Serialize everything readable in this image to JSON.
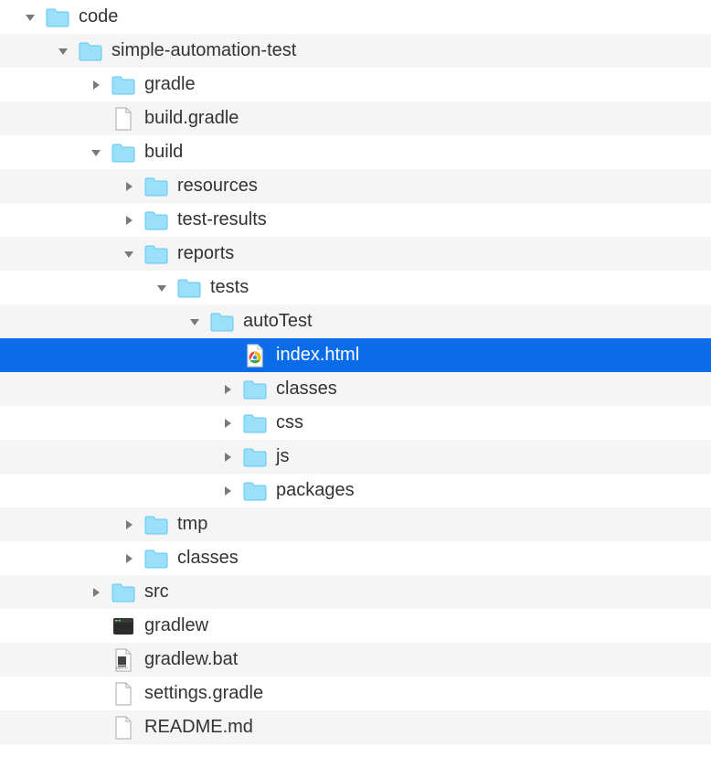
{
  "indent_unit": 36,
  "base_pad": 24,
  "colors": {
    "selection": "#0A6CE8",
    "folder_fill": "#9BDFFA",
    "folder_stroke": "#5FC8F0",
    "arrow": "#7a7a7a",
    "arrow_selected": "#ffffff",
    "file_stroke": "#b8b8b8"
  },
  "rows": [
    {
      "depth": 0,
      "arrow": "down",
      "icon": "folder",
      "label": "code",
      "selected": false
    },
    {
      "depth": 1,
      "arrow": "down",
      "icon": "folder",
      "label": "simple-automation-test",
      "selected": false
    },
    {
      "depth": 2,
      "arrow": "right",
      "icon": "folder",
      "label": "gradle",
      "selected": false
    },
    {
      "depth": 2,
      "arrow": "none",
      "icon": "file",
      "label": "build.gradle",
      "selected": false
    },
    {
      "depth": 2,
      "arrow": "down",
      "icon": "folder",
      "label": "build",
      "selected": false
    },
    {
      "depth": 3,
      "arrow": "right",
      "icon": "folder",
      "label": "resources",
      "selected": false
    },
    {
      "depth": 3,
      "arrow": "right",
      "icon": "folder",
      "label": "test-results",
      "selected": false
    },
    {
      "depth": 3,
      "arrow": "down",
      "icon": "folder",
      "label": "reports",
      "selected": false
    },
    {
      "depth": 4,
      "arrow": "down",
      "icon": "folder",
      "label": "tests",
      "selected": false
    },
    {
      "depth": 5,
      "arrow": "down",
      "icon": "folder",
      "label": "autoTest",
      "selected": false
    },
    {
      "depth": 6,
      "arrow": "none",
      "icon": "html",
      "label": "index.html",
      "selected": true
    },
    {
      "depth": 6,
      "arrow": "right",
      "icon": "folder",
      "label": "classes",
      "selected": false
    },
    {
      "depth": 6,
      "arrow": "right",
      "icon": "folder",
      "label": "css",
      "selected": false
    },
    {
      "depth": 6,
      "arrow": "right",
      "icon": "folder",
      "label": "js",
      "selected": false
    },
    {
      "depth": 6,
      "arrow": "right",
      "icon": "folder",
      "label": "packages",
      "selected": false
    },
    {
      "depth": 3,
      "arrow": "right",
      "icon": "folder",
      "label": "tmp",
      "selected": false
    },
    {
      "depth": 3,
      "arrow": "right",
      "icon": "folder",
      "label": "classes",
      "selected": false
    },
    {
      "depth": 2,
      "arrow": "right",
      "icon": "folder",
      "label": "src",
      "selected": false
    },
    {
      "depth": 2,
      "arrow": "none",
      "icon": "exec",
      "label": "gradlew",
      "selected": false
    },
    {
      "depth": 2,
      "arrow": "none",
      "icon": "batch",
      "label": "gradlew.bat",
      "selected": false
    },
    {
      "depth": 2,
      "arrow": "none",
      "icon": "file",
      "label": "settings.gradle",
      "selected": false
    },
    {
      "depth": 2,
      "arrow": "none",
      "icon": "file",
      "label": "README.md",
      "selected": false
    }
  ]
}
